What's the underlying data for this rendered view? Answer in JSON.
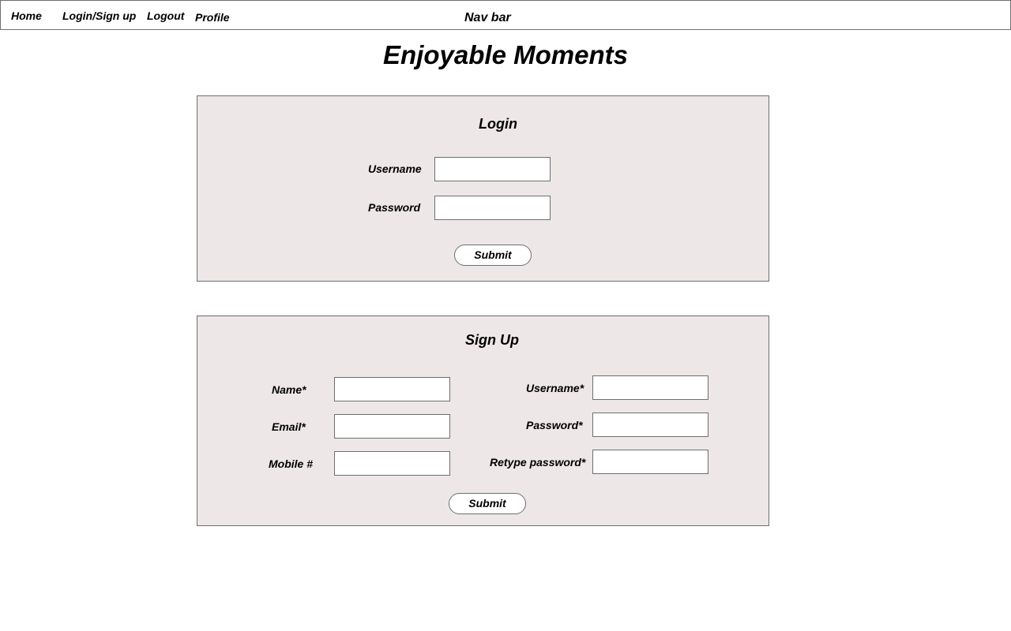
{
  "nav": {
    "items": [
      {
        "label": "Home"
      },
      {
        "label": "Login/Sign up"
      },
      {
        "label": "Logout"
      },
      {
        "label": "Profile"
      }
    ],
    "center_label": "Nav bar"
  },
  "page_title": "Enjoyable Moments",
  "login": {
    "title": "Login",
    "username_label": "Username",
    "username_value": "",
    "password_label": "Password",
    "password_value": "",
    "submit_label": "Submit"
  },
  "signup": {
    "title": "Sign Up",
    "name_label": "Name*",
    "name_value": "",
    "email_label": "Email*",
    "email_value": "",
    "mobile_label": "Mobile #",
    "mobile_value": "",
    "username_label": "Username*",
    "username_value": "",
    "password_label": "Password*",
    "password_value": "",
    "retype_password_label": "Retype password*",
    "retype_password_value": "",
    "submit_label": "Submit"
  },
  "colors": {
    "panel_background": "#ede7e7",
    "border": "#6f6f6f",
    "text": "#000000",
    "page_background": "#ffffff"
  }
}
